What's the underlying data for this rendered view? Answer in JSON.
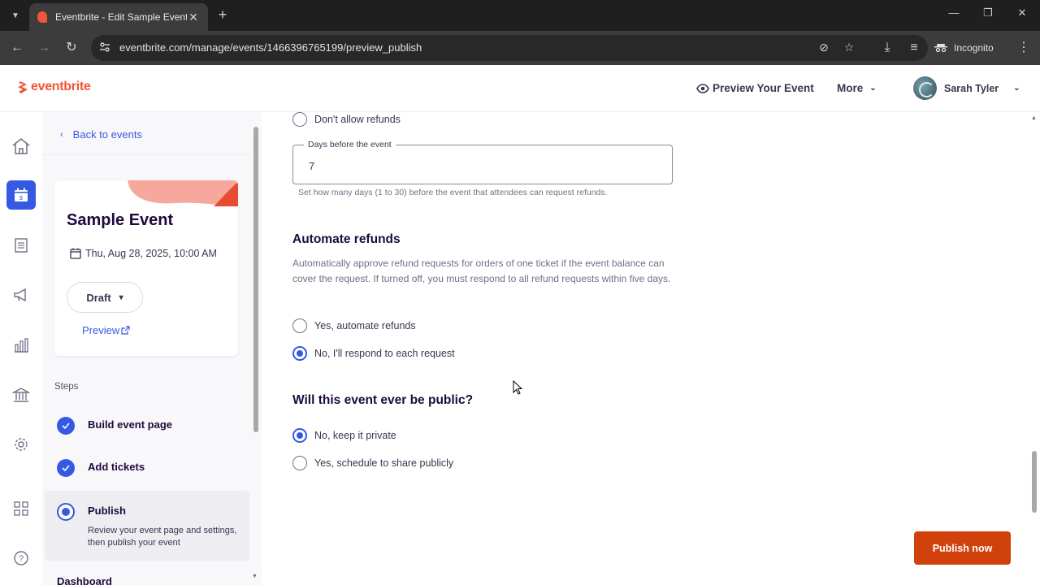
{
  "browser": {
    "tab_title": "Eventbrite - Edit Sample Event",
    "url": "eventbrite.com/manage/events/1466396765199/preview_publish",
    "incognito_label": "Incognito"
  },
  "header": {
    "logo": "eventbrite",
    "preview_label": "Preview Your Event",
    "more_label": "More",
    "user_name": "Sarah Tyler"
  },
  "sidebar": {
    "back_label": "Back to events",
    "event_title": "Sample Event",
    "event_date": "Thu, Aug 28, 2025, 10:00 AM",
    "status": "Draft",
    "preview_link": "Preview",
    "steps_label": "Steps",
    "steps": [
      {
        "label": "Build event page",
        "state": "done"
      },
      {
        "label": "Add tickets",
        "state": "done"
      },
      {
        "label": "Publish",
        "state": "current",
        "description": "Review your event page and settings, then publish your event"
      }
    ],
    "dashboard_label": "Dashboard"
  },
  "main": {
    "refund_option_none": "Don't allow refunds",
    "days_field": {
      "label": "Days before the event",
      "value": "7",
      "helper": "Set how many days (1 to 30) before the event that attendees can request refunds."
    },
    "automate": {
      "title": "Automate refunds",
      "description": "Automatically approve refund requests for orders of one ticket if the event balance can cover the request. If turned off, you must respond to all refund requests within five days.",
      "option_yes": "Yes, automate refunds",
      "option_no": "No, I'll respond to each request",
      "selected": "no"
    },
    "public": {
      "title": "Will this event ever be public?",
      "option_private": "No, keep it private",
      "option_public": "Yes, schedule to share publicly",
      "selected": "private"
    },
    "publish_button": "Publish now"
  },
  "colors": {
    "brand": "#f05537",
    "accent": "#3659e3",
    "publish": "#d1410c"
  },
  "icons": [
    "home-icon",
    "calendar-icon",
    "orders-icon",
    "megaphone-icon",
    "reports-icon",
    "bank-icon",
    "settings-icon",
    "apps-icon",
    "help-icon"
  ]
}
